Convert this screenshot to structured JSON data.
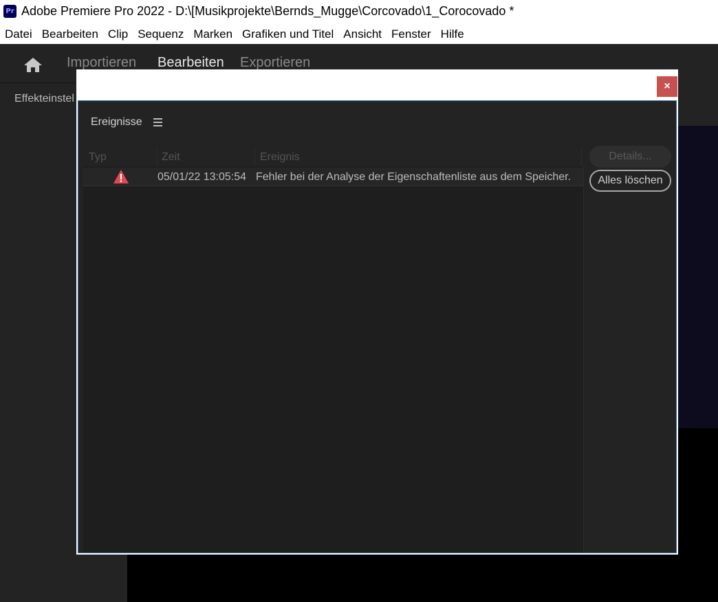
{
  "window": {
    "app_icon_text": "Pr",
    "title": "Adobe Premiere Pro 2022 - D:\\[Musikprojekte\\Bernds_Mugge\\Corcovado\\1_Corocovado *"
  },
  "menubar": {
    "items": [
      "Datei",
      "Bearbeiten",
      "Clip",
      "Sequenz",
      "Marken",
      "Grafiken und Titel",
      "Ansicht",
      "Fenster",
      "Hilfe"
    ]
  },
  "workspaces": {
    "tabs": [
      "Importieren",
      "Bearbeiten",
      "Exportieren"
    ],
    "active": "Bearbeiten"
  },
  "left_panel": {
    "title": "Effekteinstel"
  },
  "dialog": {
    "close_label": "×",
    "panel_title": "Ereignisse",
    "columns": [
      "Typ",
      "Zeit",
      "Ereignis"
    ],
    "rows": [
      {
        "type_icon": "warning-icon",
        "time": "05/01/22 13:05:54",
        "event": "Fehler bei der Analyse der Eigenschaftenliste aus dem Speicher."
      }
    ],
    "buttons": {
      "details": "Details...",
      "clear_all": "Alles löschen"
    }
  },
  "colors": {
    "accent_border": "#3a6ea5",
    "close_button": "#c75050",
    "warning": "#e34850",
    "app_icon_bg": "#00005b"
  }
}
